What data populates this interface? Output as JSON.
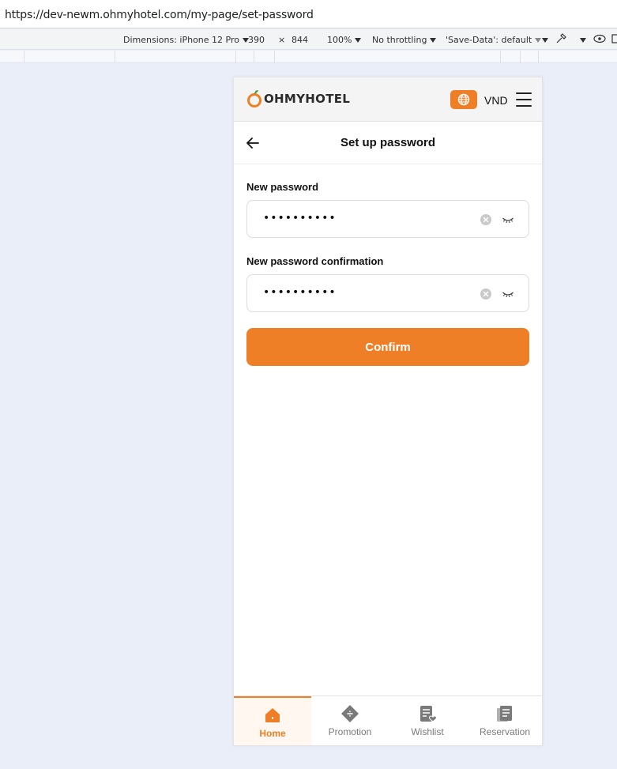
{
  "browser": {
    "url": "https://dev-newm.ohmyhotel.com/my-page/set-password"
  },
  "devtools": {
    "dimensions_label": "Dimensions: iPhone 12 Pro",
    "width": "390",
    "times": "×",
    "height": "844",
    "zoom": "100%",
    "throttling": "No throttling",
    "save_data": "'Save-Data': default"
  },
  "header": {
    "logo_text": "OHMYHOTEL",
    "currency": "VND",
    "accent_color": "#ef7f26"
  },
  "titlebar": {
    "title": "Set up password"
  },
  "form": {
    "new_password_label": "New password",
    "new_password_value": "••••••••••",
    "confirm_label": "New password confirmation",
    "confirm_value": "••••••••••",
    "confirm_button": "Confirm"
  },
  "bottom_nav": {
    "items": [
      {
        "label": "Home",
        "icon": "home-icon",
        "active": true
      },
      {
        "label": "Promotion",
        "icon": "ticket-icon",
        "active": false
      },
      {
        "label": "Wishlist",
        "icon": "wishlist-icon",
        "active": false
      },
      {
        "label": "Reservation",
        "icon": "reservation-icon",
        "active": false
      }
    ]
  }
}
